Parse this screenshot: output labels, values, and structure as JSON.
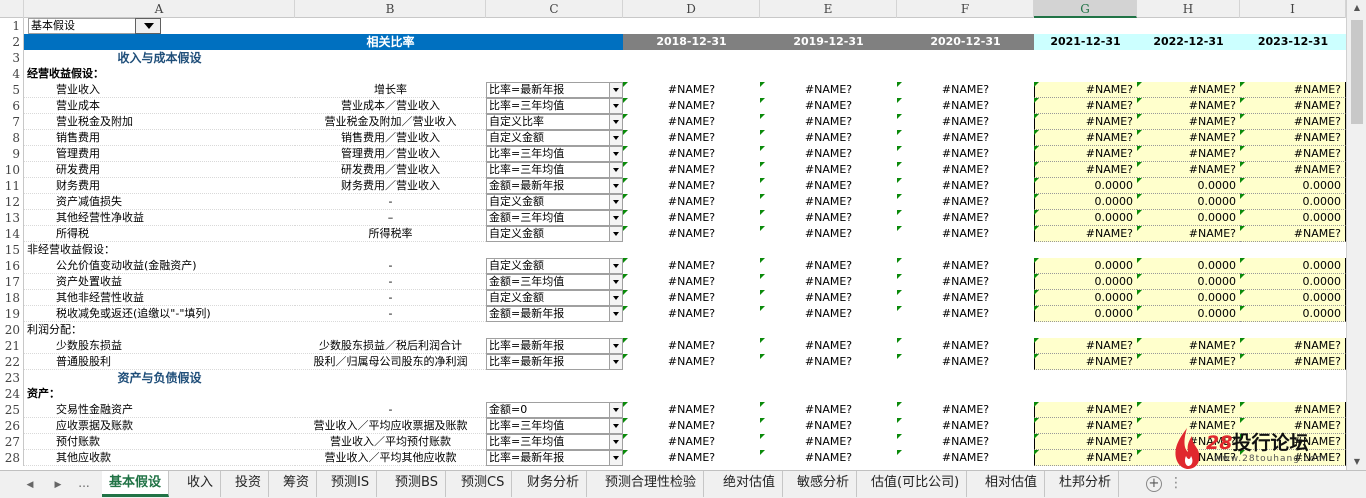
{
  "column_headers": [
    "A",
    "B",
    "C",
    "D",
    "E",
    "F",
    "G",
    "H",
    "I"
  ],
  "selected_column": "G",
  "row_numbers": [
    "1",
    "2",
    "3",
    "4",
    "5",
    "6",
    "7",
    "8",
    "9",
    "10",
    "11",
    "12",
    "13",
    "14",
    "15",
    "16",
    "17",
    "18",
    "19",
    "20",
    "21",
    "22",
    "23",
    "24",
    "25",
    "26",
    "27",
    "28"
  ],
  "dropdown_a1": "基本假设",
  "header_row": {
    "b": "相关比率",
    "dates": [
      "2018-12-31",
      "2019-12-31",
      "2020-12-31",
      "2021-12-31",
      "2022-12-31",
      "2023-12-31"
    ]
  },
  "rows": [
    {
      "type": "section",
      "a": "收入与成本假设"
    },
    {
      "type": "group",
      "a": "经营收益假设："
    },
    {
      "type": "data",
      "a": "营业收入",
      "b": "增长率",
      "c": "比率=最新年报",
      "d": "#NAME?",
      "e": "#NAME?",
      "f": "#NAME?",
      "g": "#NAME?",
      "h": "#NAME?",
      "i": "#NAME?"
    },
    {
      "type": "data",
      "a": "营业成本",
      "b": "营业成本／营业收入",
      "c": "比率=三年均值",
      "d": "#NAME?",
      "e": "#NAME?",
      "f": "#NAME?",
      "g": "#NAME?",
      "h": "#NAME?",
      "i": "#NAME?"
    },
    {
      "type": "data",
      "a": "营业税金及附加",
      "b": "营业税金及附加／营业收入",
      "c": "自定义比率",
      "d": "#NAME?",
      "e": "#NAME?",
      "f": "#NAME?",
      "g": "#NAME?",
      "h": "#NAME?",
      "i": "#NAME?"
    },
    {
      "type": "data",
      "a": "销售费用",
      "b": "销售费用／营业收入",
      "c": "自定义金额",
      "d": "#NAME?",
      "e": "#NAME?",
      "f": "#NAME?",
      "g": "#NAME?",
      "h": "#NAME?",
      "i": "#NAME?"
    },
    {
      "type": "data",
      "a": "管理费用",
      "b": "管理费用／营业收入",
      "c": "比率=三年均值",
      "d": "#NAME?",
      "e": "#NAME?",
      "f": "#NAME?",
      "g": "#NAME?",
      "h": "#NAME?",
      "i": "#NAME?"
    },
    {
      "type": "data",
      "a": "研发费用",
      "b": "研发费用／营业收入",
      "c": "比率=三年均值",
      "d": "#NAME?",
      "e": "#NAME?",
      "f": "#NAME?",
      "g": "#NAME?",
      "h": "#NAME?",
      "i": "#NAME?"
    },
    {
      "type": "data",
      "a": "财务费用",
      "b": "财务费用／营业收入",
      "c": "金额=最新年报",
      "d": "#NAME?",
      "e": "#NAME?",
      "f": "#NAME?",
      "g": "0.0000",
      "h": "0.0000",
      "i": "0.0000"
    },
    {
      "type": "data",
      "a": "资产减值损失",
      "b": "-",
      "c": "自定义金额",
      "d": "#NAME?",
      "e": "#NAME?",
      "f": "#NAME?",
      "g": "0.0000",
      "h": "0.0000",
      "i": "0.0000"
    },
    {
      "type": "data",
      "a": "其他经营性净收益",
      "b": "–",
      "c": "金额=三年均值",
      "d": "#NAME?",
      "e": "#NAME?",
      "f": "#NAME?",
      "g": "0.0000",
      "h": "0.0000",
      "i": "0.0000"
    },
    {
      "type": "data",
      "a": "所得税",
      "b": "所得税率",
      "c": "自定义金额",
      "d": "#NAME?",
      "e": "#NAME?",
      "f": "#NAME?",
      "g": "#NAME?",
      "h": "#NAME?",
      "i": "#NAME?"
    },
    {
      "type": "group",
      "a": "非经营收益假设：",
      "plain": true
    },
    {
      "type": "data",
      "a": "公允价值变动收益(金融资产)",
      "b": "-",
      "c": "自定义金额",
      "d": "#NAME?",
      "e": "#NAME?",
      "f": "#NAME?",
      "g": "0.0000",
      "h": "0.0000",
      "i": "0.0000"
    },
    {
      "type": "data",
      "a": "资产处置收益",
      "b": "-",
      "c": "金额=三年均值",
      "d": "#NAME?",
      "e": "#NAME?",
      "f": "#NAME?",
      "g": "0.0000",
      "h": "0.0000",
      "i": "0.0000"
    },
    {
      "type": "data",
      "a": "其他非经营性收益",
      "b": "-",
      "c": "自定义金额",
      "d": "#NAME?",
      "e": "#NAME?",
      "f": "#NAME?",
      "g": "0.0000",
      "h": "0.0000",
      "i": "0.0000"
    },
    {
      "type": "data",
      "a": "税收减免或返还(追缴以\"-\"填列)",
      "b": "-",
      "c": "金额=最新年报",
      "d": "#NAME?",
      "e": "#NAME?",
      "f": "#NAME?",
      "g": "0.0000",
      "h": "0.0000",
      "i": "0.0000"
    },
    {
      "type": "group",
      "a": "利润分配：",
      "plain": true
    },
    {
      "type": "data",
      "a": "少数股东损益",
      "b": "少数股东损益／税后利润合计",
      "c": "比率=最新年报",
      "d": "#NAME?",
      "e": "#NAME?",
      "f": "#NAME?",
      "g": "#NAME?",
      "h": "#NAME?",
      "i": "#NAME?"
    },
    {
      "type": "data",
      "a": "普通股股利",
      "b": "股利／归属母公司股东的净利润",
      "c": "比率=最新年报",
      "d": "#NAME?",
      "e": "#NAME?",
      "f": "#NAME?",
      "g": "#NAME?",
      "h": "#NAME?",
      "i": "#NAME?"
    },
    {
      "type": "section",
      "a": "资产与负债假设"
    },
    {
      "type": "group",
      "a": "资产："
    },
    {
      "type": "data",
      "a": "交易性金融资产",
      "b": "-",
      "c": "金额=0",
      "d": "#NAME?",
      "e": "#NAME?",
      "f": "#NAME?",
      "g": "#NAME?",
      "h": "#NAME?",
      "i": "#NAME?"
    },
    {
      "type": "data",
      "a": "应收票据及账款",
      "b": "营业收入／平均应收票据及账款",
      "c": "比率=三年均值",
      "d": "#NAME?",
      "e": "#NAME?",
      "f": "#NAME?",
      "g": "#NAME?",
      "h": "#NAME?",
      "i": "#NAME?"
    },
    {
      "type": "data",
      "a": "预付账款",
      "b": "营业收入／平均预付账款",
      "c": "比率=三年均值",
      "d": "#NAME?",
      "e": "#NAME?",
      "f": "#NAME?",
      "g": "#NAME?",
      "h": "#NAME?",
      "i": "#NAME?"
    },
    {
      "type": "data",
      "a": "其他应收款",
      "b": "营业收入／平均其他应收款",
      "c": "比率=最新年报",
      "d": "#NAME?",
      "e": "#NAME?",
      "f": "#NAME?",
      "g": "#NAME?",
      "h": "#NAME?",
      "i": "#NAME?"
    }
  ],
  "sheet_tabs": [
    "基本假设",
    "收入",
    "投资",
    "筹资",
    "预测IS",
    "预测BS",
    "预测CS",
    "财务分析",
    "预测合理性检验",
    "绝对估值",
    "敏感分析",
    "估值(可比公司)",
    "相对估值",
    "杜邦分析"
  ],
  "active_tab": 0,
  "nav": {
    "prev": "◀",
    "next": "▶",
    "more": "...",
    "add": "+"
  },
  "watermark": {
    "num": "28",
    "text": "投行论坛",
    "url": "www.28touhang.com"
  },
  "colors": {
    "header_blue": "#0070c0",
    "section_text": "#1f4e79",
    "date_gray": "#808080",
    "input_yellow": "#ffffcc",
    "forecast_header": "#ccffff",
    "excel_green": "#217346"
  }
}
